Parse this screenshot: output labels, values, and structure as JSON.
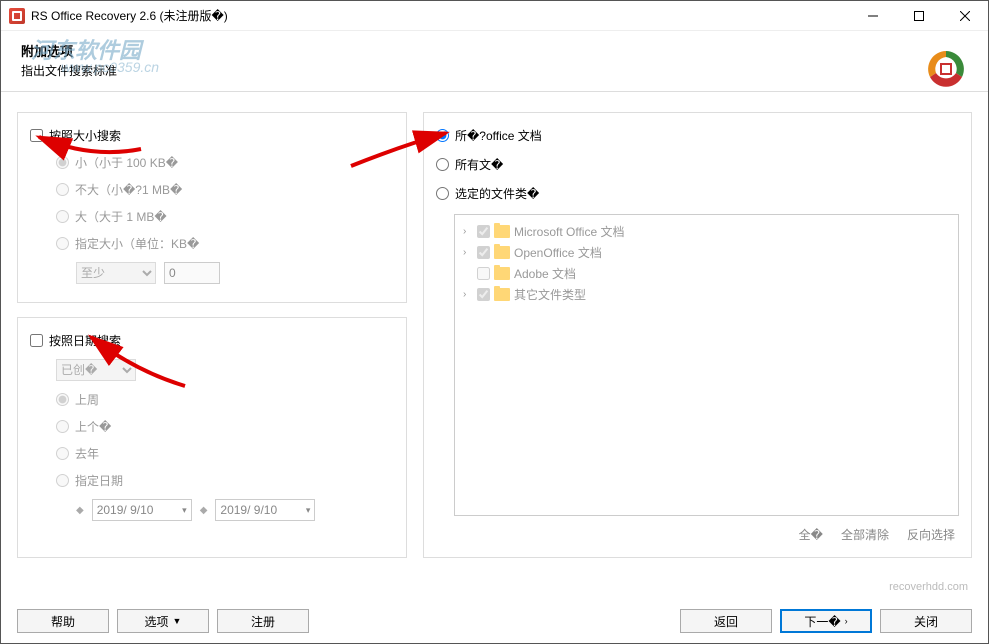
{
  "window": {
    "title": "RS Office Recovery 2.6 (未注册版�)"
  },
  "watermark": {
    "text": "河东软件园",
    "url": "www.pc0359.cn"
  },
  "header": {
    "title": "附加选项",
    "subtitle": "指出文件搜索标准"
  },
  "leftPanel": {
    "size": {
      "checkbox_label": "按照大小搜索",
      "options": {
        "small": "小（小于 100 KB�",
        "medium": "不大（小�?1 MB�",
        "large": "大（大于 1 MB�",
        "custom": "指定大小（单位：KB�"
      },
      "custom_select": "至少",
      "custom_value": "0"
    },
    "date": {
      "checkbox_label": "按照日期搜索",
      "select_value": "已创�",
      "options": {
        "last_week": "上周",
        "last_month": "上个�",
        "last_year": "去年",
        "custom": "指定日期"
      },
      "from_date": "2019/ 9/10",
      "to_date": "2019/ 9/10"
    }
  },
  "rightPanel": {
    "options": {
      "all_office": "所�?office 文档",
      "all_files": "所有文�",
      "selected_types": "选定的文件类�"
    },
    "tree": {
      "items": [
        {
          "label": "Microsoft Office 文档",
          "checked": true,
          "expandable": true
        },
        {
          "label": "OpenOffice 文档",
          "checked": true,
          "expandable": true
        },
        {
          "label": "Adobe 文档",
          "checked": false,
          "expandable": false
        },
        {
          "label": "其它文件类型",
          "checked": true,
          "expandable": true
        }
      ]
    },
    "actions": {
      "select_all": "全�",
      "clear_all": "全部清除",
      "invert": "反向选择"
    }
  },
  "footer": {
    "link": "recoverhdd.com",
    "buttons": {
      "help": "帮助",
      "options": "选项",
      "register": "注册",
      "back": "返回",
      "next": "下一�",
      "close": "关闭"
    }
  }
}
